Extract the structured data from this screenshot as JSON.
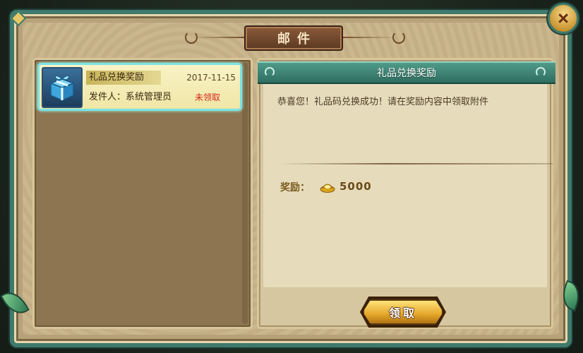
{
  "window": {
    "title": "邮件",
    "close_icon": "close-icon"
  },
  "mail_list": {
    "items": [
      {
        "subject": "礼品兑换奖励",
        "date": "2017-11-15",
        "sender": "发件人：系统管理员",
        "status": "未领取",
        "icon": "gift-box-icon",
        "selected": true
      }
    ]
  },
  "mail_detail": {
    "header": "礼品兑换奖励",
    "body": "恭喜您！礼品码兑换成功！请在奖励内容中领取附件",
    "reward_label": "奖励：",
    "reward_icon": "gold-ingot-icon",
    "reward_value": "5000",
    "claim_label": "领取"
  },
  "colors": {
    "frame_teal": "#3f7a6c",
    "panel_tan": "#c9b48a",
    "status_red": "#d8261a",
    "button_gold": "#e4a72a"
  }
}
